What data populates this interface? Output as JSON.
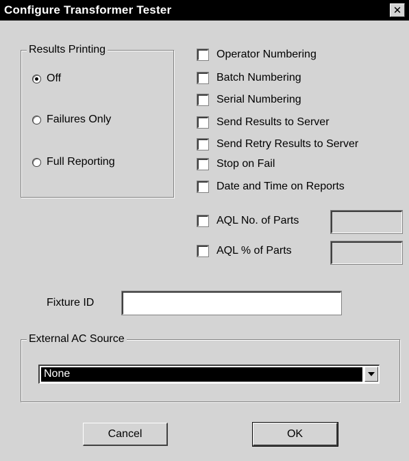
{
  "window": {
    "title": "Configure Transformer Tester",
    "close_glyph": "✕"
  },
  "results_printing": {
    "legend": "Results Printing",
    "options": [
      {
        "label": "Off",
        "checked": true
      },
      {
        "label": "Failures Only",
        "checked": false
      },
      {
        "label": "Full Reporting",
        "checked": false
      }
    ]
  },
  "options": {
    "checkboxes": [
      {
        "label": "Operator Numbering",
        "checked": false
      },
      {
        "label": "Batch Numbering",
        "checked": false
      },
      {
        "label": "Serial Numbering",
        "checked": false
      },
      {
        "label": "Send Results to Server",
        "checked": false
      },
      {
        "label": "Send Retry Results to Server",
        "checked": false
      },
      {
        "label": "Stop on Fail",
        "checked": false
      },
      {
        "label": "Date and Time on Reports",
        "checked": false
      }
    ],
    "aql_no": {
      "label": "AQL No. of Parts",
      "value": ""
    },
    "aql_pct": {
      "label": "AQL % of Parts",
      "value": ""
    }
  },
  "fixture": {
    "label": "Fixture ID",
    "value": ""
  },
  "external_ac": {
    "legend": "External AC Source",
    "selected": "None"
  },
  "buttons": {
    "cancel": "Cancel",
    "ok": "OK"
  },
  "icons": {
    "close": "close-icon",
    "dropdown": "chevron-down-icon"
  }
}
